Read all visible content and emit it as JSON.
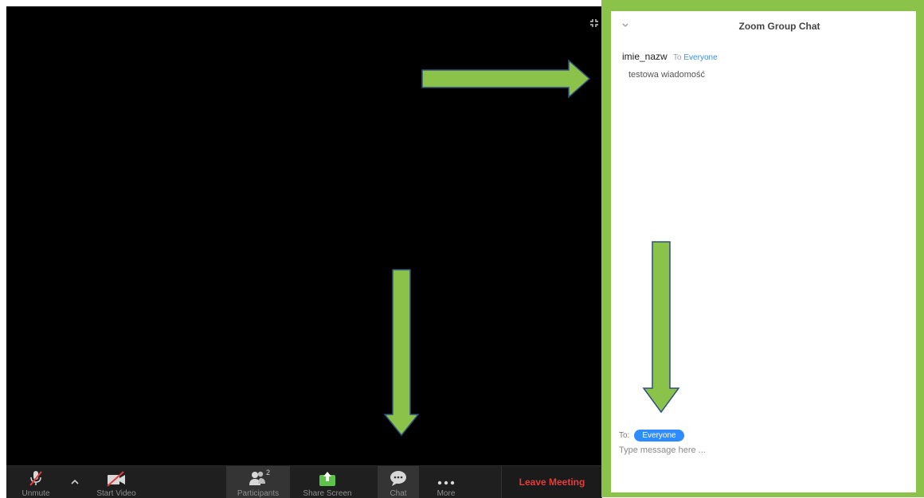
{
  "toolbar": {
    "unmute_label": "Unmute",
    "start_video_label": "Start Video",
    "participants_label": "Participants",
    "participants_count": "2",
    "share_screen_label": "Share Screen",
    "chat_label": "Chat",
    "more_label": "More",
    "leave_label": "Leave Meeting"
  },
  "chat": {
    "title": "Zoom Group Chat",
    "message": {
      "sender": "imie_nazw",
      "to_prefix": "To",
      "to_target": "Everyone",
      "text": "testowa wiadomość"
    },
    "to_label": "To:",
    "recipient": "Everyone",
    "input_placeholder": "Type message here ..."
  },
  "colors": {
    "highlight_green": "#8bc34a",
    "leave_red": "#e03d3d",
    "accent_blue": "#2d8cff",
    "share_green": "#5cc34a"
  },
  "icons": [
    "fullscreen-exit-icon",
    "microphone-muted-icon",
    "chevron-up-icon",
    "video-off-icon",
    "participants-icon",
    "share-screen-icon",
    "chat-icon",
    "more-dots-icon",
    "chevron-down-icon",
    "arrow-right-icon",
    "arrow-down-icon"
  ]
}
